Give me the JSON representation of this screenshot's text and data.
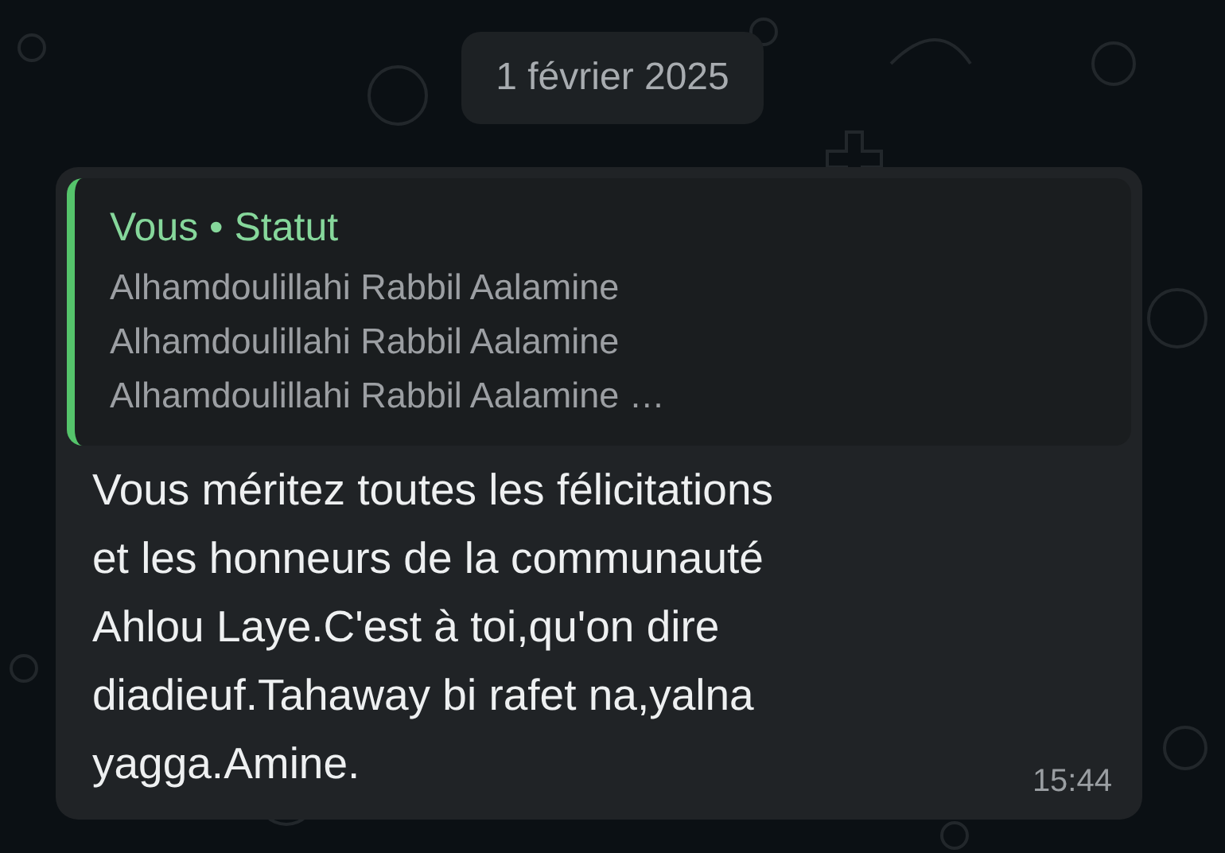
{
  "date_chip": "1 février 2025",
  "message": {
    "quote": {
      "author": "Vous • Statut",
      "text": "Alhamdoulillahi Rabbil Aalamine\nAlhamdoulillahi Rabbil Aalamine\nAlhamdoulillahi Rabbil Aalamine …"
    },
    "text": "Vous méritez toutes les félicitations\net les honneurs de la communauté\nAhlou Laye.C'est à toi,qu'on dire\ndiadieuf.Tahaway bi rafet na,yalna\nyagga.Amine.",
    "time": "15:44"
  }
}
